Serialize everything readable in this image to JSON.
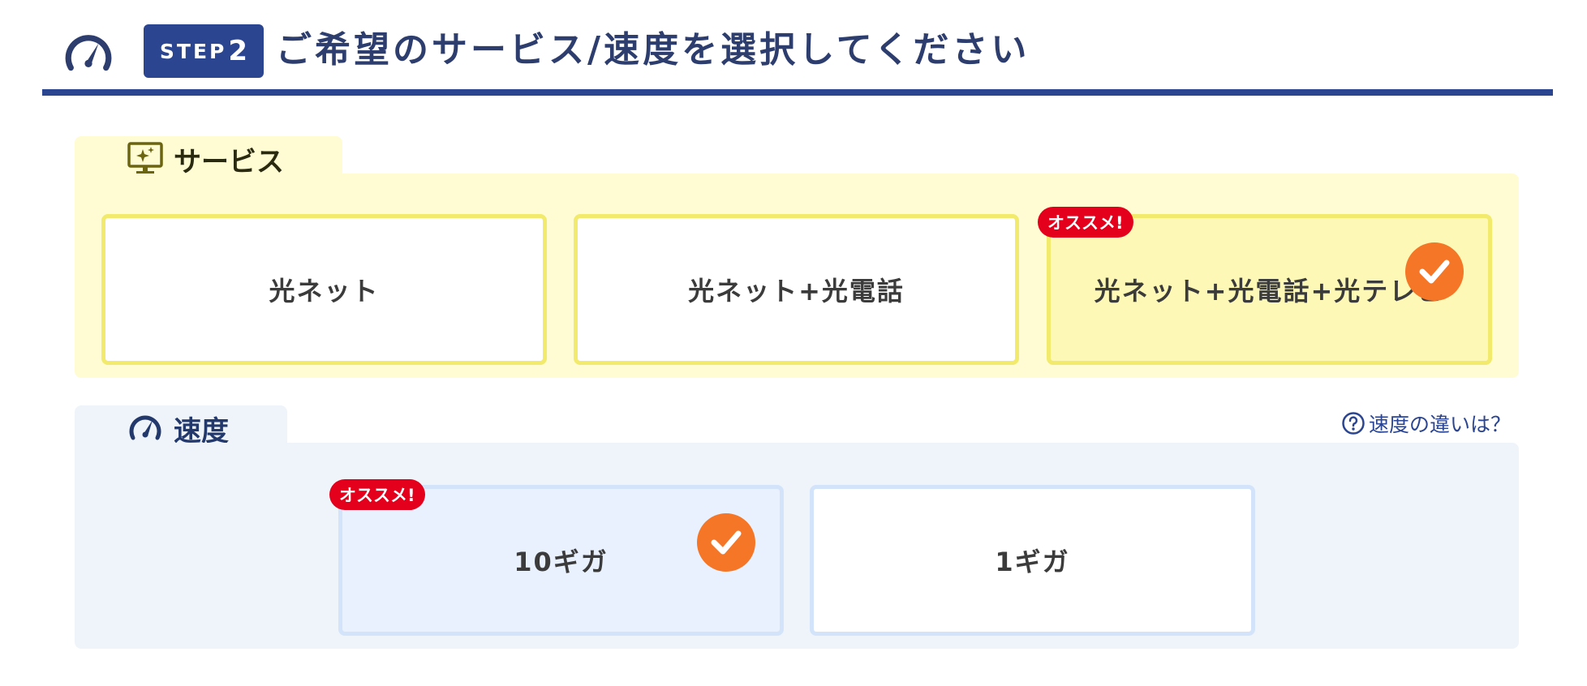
{
  "header": {
    "step_prefix": "STEP",
    "step_number": "2",
    "title": "ご希望のサービス/速度を選択してください"
  },
  "service": {
    "heading": "サービス",
    "options": [
      {
        "label": "光ネット",
        "selected": false
      },
      {
        "label": "光ネット+光電話",
        "selected": false
      },
      {
        "label": "光ネット+光電話+光テレビ",
        "selected": true,
        "badge": "オススメ!"
      }
    ]
  },
  "speed": {
    "heading": "速度",
    "help_link": "速度の違いは？",
    "options": [
      {
        "label": "10ギガ",
        "selected": true,
        "badge": "オススメ!"
      },
      {
        "label": "1ギガ",
        "selected": false
      }
    ]
  },
  "colors": {
    "navy": "#2b4590",
    "service_bg": "#fffcd4",
    "service_border": "#f2ea6c",
    "speed_bg": "#eff4fb",
    "speed_border": "#d3e3f9",
    "check": "#f47626",
    "badge": "#e4001c"
  },
  "icons": {
    "header": "speedometer-icon",
    "service": "monitor-sparkle-icon",
    "speed": "speedometer-icon",
    "help": "question-circle-icon",
    "selected": "checkmark-icon"
  }
}
